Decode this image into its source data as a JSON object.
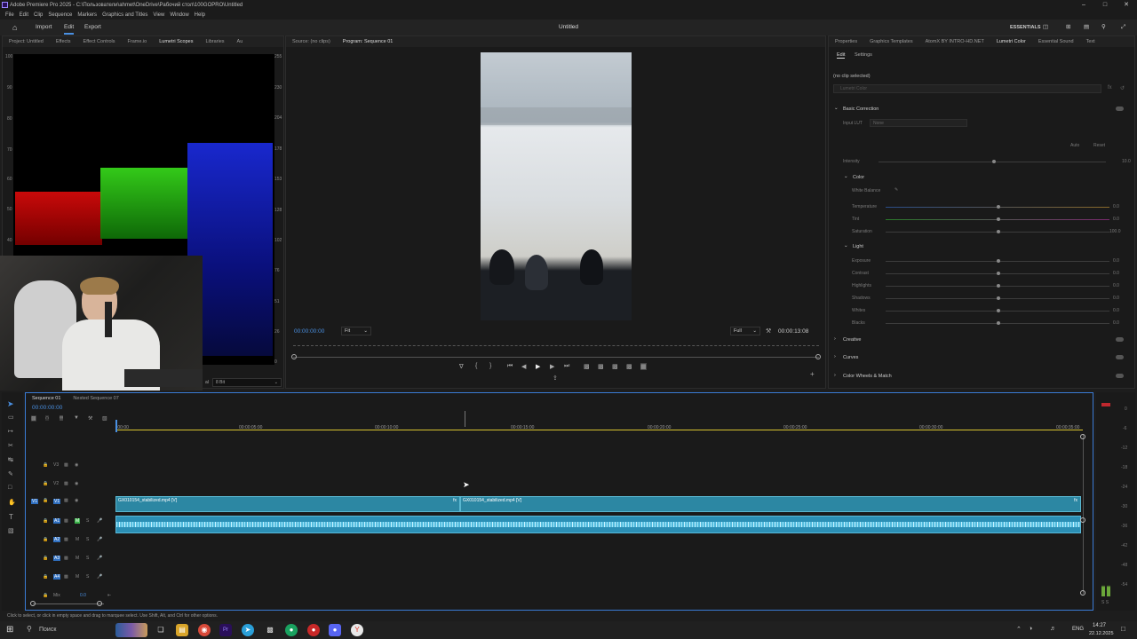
{
  "window": {
    "title": "Adobe Premiere Pro 2025 - C:\\Пользователи\\ahmet\\OneDrive\\Рабочий стол\\100GOPRO\\Untitled"
  },
  "menu": [
    "File",
    "Edit",
    "Clip",
    "Sequence",
    "Markers",
    "Graphics and Titles",
    "View",
    "Window",
    "Help"
  ],
  "header": {
    "import": "Import",
    "edit": "Edit",
    "export": "Export",
    "project_title": "Untitled",
    "workspace": "ESSENTIALS"
  },
  "left_panel": {
    "tabs": [
      "Project: Untitled",
      "Effects",
      "Effect Controls",
      "Frame.io",
      "Lumetri Scopes",
      "Libraries",
      "Au"
    ],
    "scale_left": [
      "100",
      "90",
      "80",
      "70",
      "60",
      "50",
      "40"
    ],
    "scale_right": [
      "255",
      "230",
      "204",
      "178",
      "153",
      "128",
      "102",
      "76",
      "51",
      "26",
      "0"
    ],
    "bit_depth": "8 Bit",
    "partial_label": "al"
  },
  "monitor": {
    "source_tab": "Source: (no clips)",
    "program_tab": "Program: Sequence 01",
    "timecode": "00:00:00:00",
    "fit": "Fit",
    "quality": "Full",
    "duration": "00:00:13:08"
  },
  "right_panel": {
    "tabs": [
      "Properties",
      "Graphics Templates",
      "AtomX BY INTRO-HD.NET",
      "Lumetri Color",
      "Essential Sound",
      "Text"
    ],
    "subtabs": [
      "Edit",
      "Settings"
    ],
    "no_clip": "(no clip selected)",
    "lumetri_dropdown": "Lumetri Color",
    "basic_correction": "Basic Correction",
    "input_lut": "Input LUT",
    "lut_value": "None",
    "auto": "Auto",
    "reset": "Reset",
    "intensity": "Intensity",
    "intensity_val": "10.0",
    "color": "Color",
    "white_balance": "White Balance",
    "temperature": "Temperature",
    "tint": "Tint",
    "saturation": "Saturation",
    "saturation_val": "100.0",
    "zero": "0.0",
    "light": "Light",
    "light_items": [
      "Exposure",
      "Contrast",
      "Highlights",
      "Shadows",
      "Whites",
      "Blacks"
    ],
    "creative": "Creative",
    "curves": "Curves",
    "color_wheels": "Color Wheels & Match"
  },
  "timeline": {
    "tabs": [
      "Sequence 01",
      "Nested Sequence 07"
    ],
    "timecode": "00:00:00:00",
    "ruler": [
      ":00:00",
      "00:00:05:00",
      "00:00:10:00",
      "00:00:15:00",
      "00:00:20:00",
      "00:00:25:00",
      "00:00:30:00",
      "00:00:35:00"
    ],
    "video_tracks": [
      "V3",
      "V2",
      "V1"
    ],
    "audio_tracks": [
      "A1",
      "A2",
      "A3",
      "A4"
    ],
    "mix": "Mix",
    "mix_val": "0.0",
    "clip1": "GX010154_stabilized.mp4 [V]",
    "clip2": "GX010154_stabilized.mp4 [V]",
    "m": "M",
    "s": "S",
    "v1_target": "V1"
  },
  "meter": {
    "scale": [
      "0",
      "-6",
      "-12",
      "-18",
      "-24",
      "-30",
      "-36",
      "-42",
      "-48",
      "-54"
    ],
    "ss": "S  S"
  },
  "status": {
    "text": "Click to select, or click in empty space and drag to marquee select. Use Shift, Alt, and Ctrl for other options."
  },
  "taskbar": {
    "search": "Поиск",
    "lang": "ENG",
    "time": "14:27",
    "date": "22.12.2025"
  }
}
